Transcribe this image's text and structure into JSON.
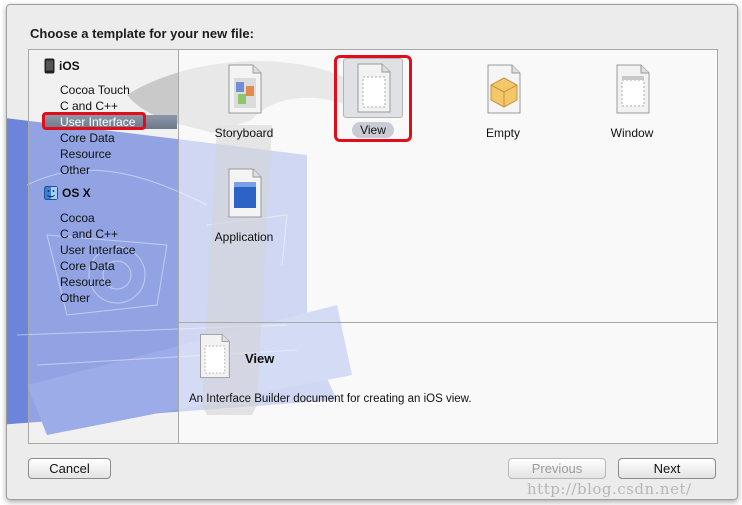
{
  "dialog": {
    "title": "Choose a template for your new file:"
  },
  "sidebar": {
    "groups": [
      {
        "name": "iOS",
        "icon": "iphone-icon",
        "items": [
          "Cocoa Touch",
          "C and C++",
          "User Interface",
          "Core Data",
          "Resource",
          "Other"
        ],
        "selected": "User Interface"
      },
      {
        "name": "OS X",
        "icon": "finder-icon",
        "items": [
          "Cocoa",
          "C and C++",
          "User Interface",
          "Core Data",
          "Resource",
          "Other"
        ]
      }
    ]
  },
  "templates": [
    {
      "label": "Storyboard",
      "icon": "storyboard-icon"
    },
    {
      "label": "View",
      "icon": "view-document-icon",
      "selected": true
    },
    {
      "label": "Empty",
      "icon": "empty-cube-icon"
    },
    {
      "label": "Window",
      "icon": "window-document-icon"
    },
    {
      "label": "Application",
      "icon": "application-document-icon"
    }
  ],
  "detail": {
    "title": "View",
    "description": "An Interface Builder document for creating an iOS view."
  },
  "buttons": {
    "cancel": "Cancel",
    "previous": "Previous",
    "next": "Next"
  },
  "watermark": "http://blog.csdn.net/",
  "colors": {
    "highlight": "#e30d1a",
    "selection": "#7a8497",
    "blueprint": "#4d67c7"
  }
}
